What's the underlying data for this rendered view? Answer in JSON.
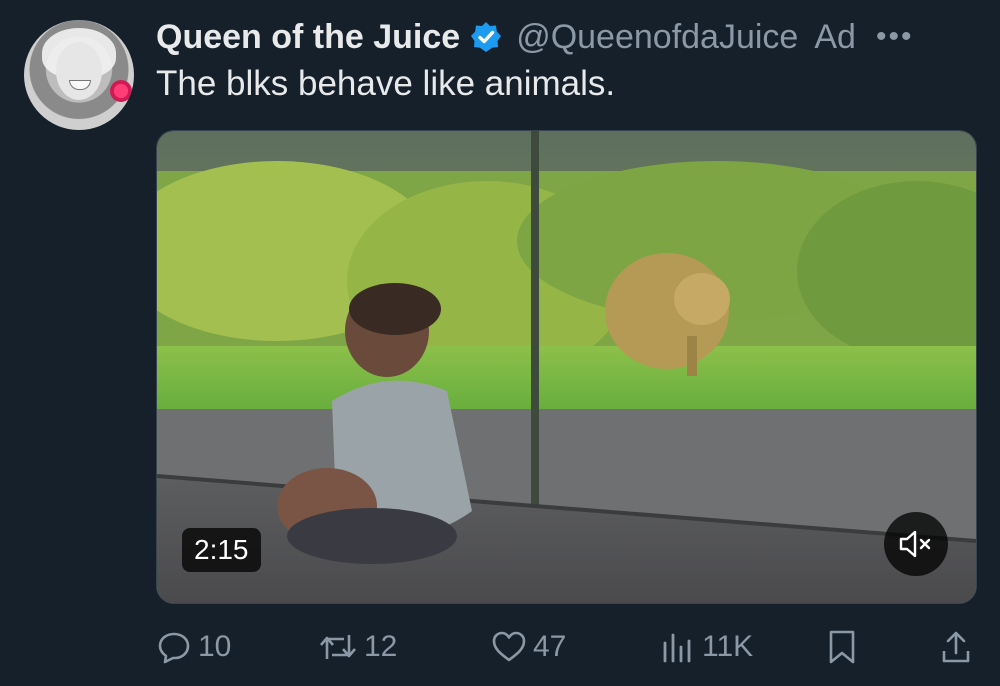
{
  "tweet": {
    "author_name": "Queen of the Juice",
    "handle": "@QueenofdaJuice",
    "ad_label": "Ad",
    "more_icon": "more-icon",
    "verified_icon": "verified-badge-icon",
    "text": "The blks behave like animals.",
    "colors": {
      "background": "#15202b",
      "verified": "#1d9bf0",
      "secondary_text": "#8b98a5"
    }
  },
  "media": {
    "type": "video",
    "duration": "2:15",
    "mute_icon": "speaker-muted-icon"
  },
  "actions": {
    "reply": {
      "icon": "reply-icon",
      "count": "10"
    },
    "repost": {
      "icon": "repost-icon",
      "count": "12"
    },
    "like": {
      "icon": "heart-icon",
      "count": "47"
    },
    "views": {
      "icon": "views-icon",
      "count": "11K"
    },
    "bookmark": {
      "icon": "bookmark-icon"
    },
    "share": {
      "icon": "share-icon"
    }
  }
}
